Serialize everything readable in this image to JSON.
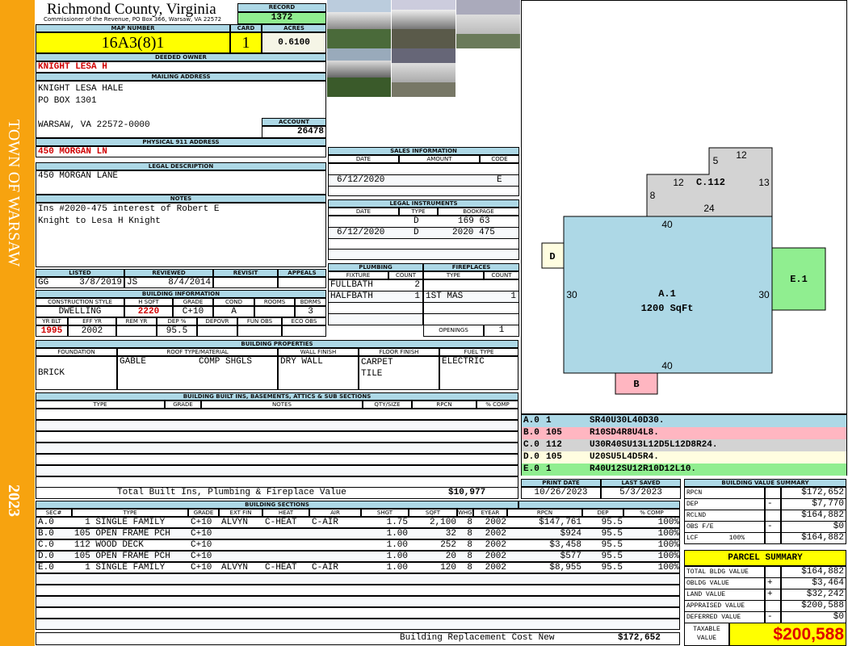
{
  "sidebar": {
    "town": "TOWN OF WARSAW",
    "year": "2023"
  },
  "header": {
    "county": "Richmond County, Virginia",
    "office": "Commissioner of the Revenue, PO Box 366, Warsaw, VA 22572",
    "record_label": "RECORD",
    "record": "1372"
  },
  "parcel": {
    "map_label": "MAP NUMBER",
    "map": "16A3(8)1",
    "card_label": "CARD",
    "card": "1",
    "acres_label": "ACRES",
    "acres": "0.6100"
  },
  "owner": {
    "label": "DEEDED OWNER",
    "name": "KNIGHT LESA H",
    "mail_label": "MAILING ADDRESS",
    "mail1": "KNIGHT LESA HALE",
    "mail2": "PO BOX 1301",
    "mail3": "WARSAW, VA 22572-0000",
    "account_label": "ACCOUNT",
    "account": "26478",
    "addr_label": "PHYSICAL 911 ADDRESS",
    "addr": "450 MORGAN LN"
  },
  "legal": {
    "label": "LEGAL DESCRIPTION",
    "value": "450 MORGAN LANE"
  },
  "notes": {
    "label": "NOTES",
    "line1": "Ins #2020-475 interest of Robert E",
    "line2": "Knight to Lesa H Knight"
  },
  "review": {
    "listed_label": "LISTED",
    "reviewed_label": "REVIEWED",
    "revisit_label": "REVISIT",
    "appeals_label": "APPEALS",
    "listed_by": "GG",
    "listed": "3/8/2019",
    "reviewed_by": "JS",
    "reviewed": "8/4/2014"
  },
  "building_info": {
    "label": "BUILDING INFORMATION",
    "h": [
      "CONSTRUCTION STYLE",
      "H SQFT",
      "GRADE",
      "COND",
      "ROOMS",
      "BDRMS"
    ],
    "v": [
      "DWELLING",
      "2220",
      "C+10",
      "A",
      "",
      "3"
    ],
    "h2": [
      "YR BLT",
      "EFF YR",
      "REM YR",
      "DEP %",
      "DEPOVR",
      "FUN OBS",
      "ECO OBS"
    ],
    "v2": [
      "1995",
      "2002",
      "",
      "95.5",
      "",
      "",
      ""
    ]
  },
  "sales": {
    "label": "SALES INFORMATION",
    "h": [
      "DATE",
      "AMOUNT",
      "CODE"
    ],
    "date": "6/12/2020",
    "code": "E"
  },
  "instruments": {
    "label": "LEGAL INSTRUMENTS",
    "h": [
      "DATE",
      "TYPE",
      "BOOKPAGE"
    ],
    "rows": [
      {
        "date": "",
        "type": "D",
        "bp": "169 63"
      },
      {
        "date": "6/12/2020",
        "type": "D",
        "bp": "2020 475"
      }
    ]
  },
  "plumbing": {
    "label": "PLUMBING",
    "h": [
      "FIXTURE",
      "COUNT"
    ],
    "rows": [
      {
        "f": "FULLBATH",
        "c": "2"
      },
      {
        "f": "HALFBATH",
        "c": "1"
      }
    ]
  },
  "fireplaces": {
    "label": "FIREPLACES",
    "h": [
      "TYPE",
      "COUNT"
    ],
    "type": "1ST MAS",
    "count": "1",
    "openings_label": "OPENINGS",
    "openings": "1"
  },
  "properties": {
    "label": "BUILDING PROPERTIES",
    "h": [
      "FOUNDATION",
      "ROOF TYPE/MATERIAL",
      "WALL FINISH",
      "FLOOR FINISH",
      "FUEL TYPE"
    ],
    "foundation": "BRICK",
    "roof_type": "GABLE",
    "roof_mat": "COMP SHGLS",
    "wall": "DRY WALL",
    "floor1": "CARPET",
    "floor2": "TILE",
    "fuel": "ELECTRIC"
  },
  "builtins": {
    "label": "BUILDING BUILT INS, BASEMENTS, ATTICS & SUB SECTIONS",
    "h": [
      "TYPE",
      "GRADE",
      "NOTES",
      "QTY/SIZE",
      "RPCN",
      "% COMP"
    ],
    "total_label": "Total Built Ins, Plumbing & Fireplace Value",
    "total": "$10,977"
  },
  "dates": {
    "print_label": "PRINT DATE",
    "print": "10/26/2023",
    "saved_label": "LAST SAVED",
    "saved": "5/3/2023"
  },
  "sketch": {
    "A_label": "A.1",
    "A_area": "1200 SqFt",
    "A_top": "40",
    "A_bottom": "40",
    "A_left": "30",
    "A_right": "30",
    "B": "B",
    "C": "C.112",
    "C_dims": [
      "5",
      "12",
      "13",
      "12",
      "8",
      "24"
    ],
    "D": "D",
    "E": "E.1",
    "codes": [
      {
        "sec": "A.0",
        "code": "1",
        "path": "SR40U30L40D30.",
        "color": "#add8e6"
      },
      {
        "sec": "B.0",
        "code": "105",
        "path": "R10SD4R8U4L8.",
        "color": "#ffb6c1"
      },
      {
        "sec": "C.0",
        "code": "112",
        "path": "U30R40SU13L12D5L12D8R24.",
        "color": "#d3d3d3"
      },
      {
        "sec": "D.0",
        "code": "105",
        "path": "U20SU5L4D5R4.",
        "color": "#fffde0"
      },
      {
        "sec": "E.0",
        "code": "1",
        "path": "R40U12SU12R10D12L10.",
        "color": "#90ee90"
      }
    ]
  },
  "sections": {
    "label": "BUILDING SECTIONS",
    "h": [
      "SEC#",
      "TYPE",
      "GRADE",
      "EXT FIN",
      "HEAT",
      "AIR",
      "SHGT",
      "SQFT",
      "WHGT",
      "EYEAR",
      "RPCN",
      "DEP",
      "% COMP"
    ],
    "rows": [
      [
        "A.0",
        "  1 SINGLE FAMILY",
        "C+10",
        "ALVYN",
        "C-HEAT",
        "C-AIR",
        "1.75",
        "2,100",
        "8",
        "2002",
        "$147,761",
        "95.5",
        "100%"
      ],
      [
        "B.0",
        "105 OPEN FRAME PCH",
        "C+10",
        "",
        "",
        "",
        "1.00",
        "32",
        "8",
        "2002",
        "$924",
        "95.5",
        "100%"
      ],
      [
        "C.0",
        "112 WOOD DECK",
        "C+10",
        "",
        "",
        "",
        "1.00",
        "252",
        "8",
        "2002",
        "$3,458",
        "95.5",
        "100%"
      ],
      [
        "D.0",
        "105 OPEN FRAME PCH",
        "C+10",
        "",
        "",
        "",
        "1.00",
        "20",
        "8",
        "2002",
        "$577",
        "95.5",
        "100%"
      ],
      [
        "E.0",
        "  1 SINGLE FAMILY",
        "C+10",
        "ALVYN",
        "C-HEAT",
        "C-AIR",
        "1.00",
        "120",
        "8",
        "2002",
        "$8,955",
        "95.5",
        "100%"
      ]
    ],
    "total_label": "Building Replacement Cost New",
    "total": "$172,652"
  },
  "value_summary": {
    "label": "BUILDING VALUE SUMMARY",
    "rows": [
      {
        "l": "RPCN",
        "s": "",
        "v": "$172,652"
      },
      {
        "l": "DEP",
        "s": "-",
        "v": "$7,770"
      },
      {
        "l": "RCLND",
        "s": "",
        "v": "$164,882"
      },
      {
        "l": "OBS F/E",
        "s": "-",
        "v": "$0"
      },
      {
        "l": "LCF        100%",
        "s": "",
        "v": "$164,882"
      }
    ]
  },
  "parcel_summary": {
    "label": "PARCEL SUMMARY",
    "rows": [
      {
        "l": "TOTAL BLDG VALUE",
        "s": "",
        "v": "$164,882"
      },
      {
        "l": "OBLDG VALUE",
        "s": "+",
        "v": "$3,464"
      },
      {
        "l": "LAND VALUE",
        "s": "+",
        "v": "$32,242"
      },
      {
        "l": "APPRAISED VALUE",
        "s": "",
        "v": "$200,588"
      },
      {
        "l": "DEFERRED VALUE",
        "s": "-",
        "v": "$0"
      }
    ],
    "taxable_label1": "TAXABLE",
    "taxable_label2": "VALUE",
    "taxable": "$200,588"
  }
}
